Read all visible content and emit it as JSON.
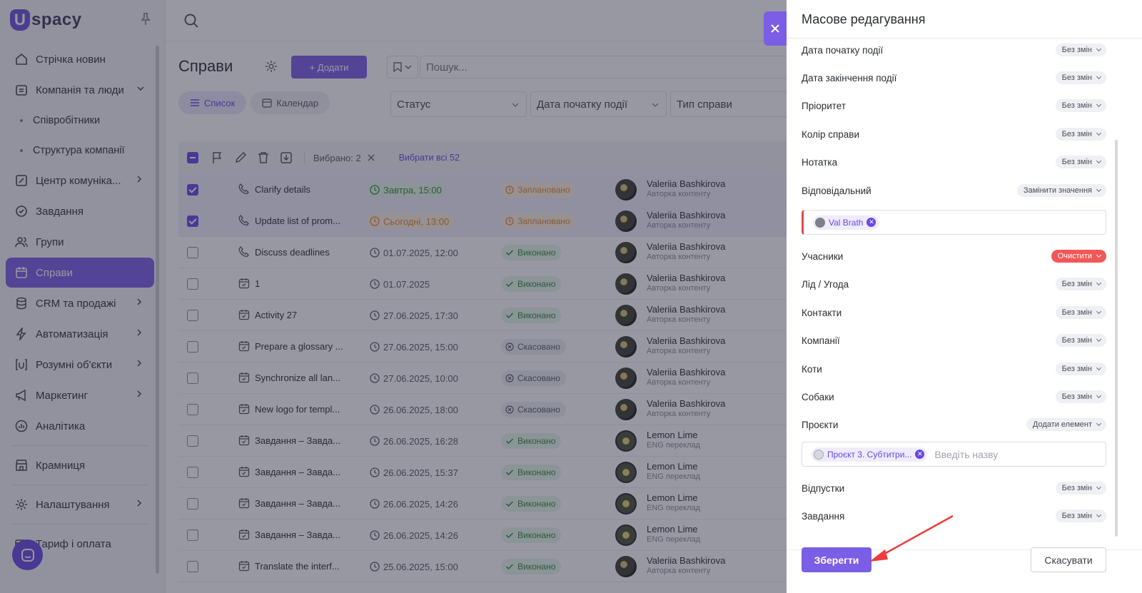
{
  "sidebar": {
    "logo": "spacy",
    "logo_mark": "U",
    "items": [
      {
        "label": "Стрічка новин",
        "icon": "home-icon"
      },
      {
        "label": "Компанія та люди",
        "icon": "building-icon"
      },
      {
        "label": "Співробітники"
      },
      {
        "label": "Структура компанії"
      },
      {
        "label": "Центр комуніка...",
        "icon": "chat-edit-icon"
      },
      {
        "label": "Завдання",
        "icon": "check-circle-icon"
      },
      {
        "label": "Групи",
        "icon": "group-icon"
      },
      {
        "label": "Справи",
        "icon": "calendar-icon"
      },
      {
        "label": "CRM та продажі",
        "icon": "database-icon"
      },
      {
        "label": "Автоматизація",
        "icon": "lightning-icon"
      },
      {
        "label": "Розумні об'єкти",
        "icon": "smart-object-icon"
      },
      {
        "label": "Маркетинг",
        "icon": "megaphone-icon"
      },
      {
        "label": "Аналітика",
        "icon": "chart-icon"
      },
      {
        "label": "Крамниця",
        "icon": "store-icon"
      },
      {
        "label": "Налаштування",
        "icon": "gear-icon"
      },
      {
        "label": "Тариф і оплата",
        "icon": "card-icon"
      }
    ]
  },
  "main": {
    "title": "Справи",
    "add_label": "+ Додати",
    "search_placeholder": "Пошук...",
    "views": {
      "list": "Список",
      "calendar": "Календар"
    },
    "filters": [
      "Статус",
      "Дата початку події",
      "Тип справи"
    ],
    "toolbar": {
      "selected": "Вибрано: 2",
      "select_all": "Вибрати всі 52"
    },
    "rows": [
      {
        "name": "Clarify details",
        "date": "Завтра, 15:00",
        "status": "Заплановано",
        "person": "Valeriia Bashkirova",
        "role": "Авторка контенту",
        "selected": true
      },
      {
        "name": "Update list of prom...",
        "date": "Сьогодні, 13:00",
        "status": "Заплановано",
        "person": "Valeriia Bashkirova",
        "role": "Авторка контенту",
        "selected": true
      },
      {
        "name": "Discuss deadlines",
        "date": "01.07.2025, 12:00",
        "status": "Виконано",
        "person": "Valeriia Bashkirova",
        "role": "Авторка контенту",
        "selected": false
      },
      {
        "name": "1",
        "date": "01.07.2025",
        "status": "Виконано",
        "person": "Valeriia Bashkirova",
        "role": "Авторка контенту",
        "selected": false
      },
      {
        "name": "Activity 27",
        "date": "27.06.2025, 17:30",
        "status": "Виконано",
        "person": "Valeriia Bashkirova",
        "role": "Авторка контенту",
        "selected": false
      },
      {
        "name": "Prepare a glossary ...",
        "date": "27.06.2025, 15:00",
        "status": "Скасовано",
        "person": "Valeriia Bashkirova",
        "role": "Авторка контенту",
        "selected": false
      },
      {
        "name": "Synchronize all lan...",
        "date": "27.06.2025, 10:00",
        "status": "Скасовано",
        "person": "Valeriia Bashkirova",
        "role": "Авторка контенту",
        "selected": false
      },
      {
        "name": "New logo for templ...",
        "date": "26.06.2025, 18:00",
        "status": "Скасовано",
        "person": "Valeriia Bashkirova",
        "role": "Авторка контенту",
        "selected": false
      },
      {
        "name": "Завдання – Завда...",
        "date": "26.06.2025, 16:28",
        "status": "Виконано",
        "person": "Lemon Lime",
        "role": "ENG переклад",
        "selected": false
      },
      {
        "name": "Завдання – Завда...",
        "date": "26.06.2025, 15:37",
        "status": "Виконано",
        "person": "Lemon Lime",
        "role": "ENG переклад",
        "selected": false
      },
      {
        "name": "Завдання – Завда...",
        "date": "26.06.2025, 14:26",
        "status": "Виконано",
        "person": "Lemon Lime",
        "role": "ENG переклад",
        "selected": false
      },
      {
        "name": "Завдання – Завда...",
        "date": "26.06.2025, 14:26",
        "status": "Виконано",
        "person": "Lemon Lime",
        "role": "ENG переклад",
        "selected": false
      },
      {
        "name": "Translate the interf...",
        "date": "25.06.2025, 15:00",
        "status": "Виконано",
        "person": "Valeriia Bashkirova",
        "role": "Авторка контенту",
        "selected": false
      }
    ]
  },
  "panel": {
    "title": "Масове редагування",
    "fields": [
      {
        "label": "Дата початку події",
        "value": "Без змін"
      },
      {
        "label": "Дата закінчення події",
        "value": "Без змін"
      },
      {
        "label": "Пріоритет",
        "value": "Без змін"
      },
      {
        "label": "Колір справи",
        "value": "Без змін"
      },
      {
        "label": "Нотатка",
        "value": "Без змін"
      },
      {
        "label": "Відповідальний",
        "value": "Замінити значення"
      },
      {
        "label": "Учасники",
        "value": "Очистити"
      },
      {
        "label": "Лід / Угода",
        "value": "Без змін"
      },
      {
        "label": "Контакти",
        "value": "Без змін"
      },
      {
        "label": "Компанії",
        "value": "Без змін"
      },
      {
        "label": "Коти",
        "value": "Без змін"
      },
      {
        "label": "Собаки",
        "value": "Без змін"
      },
      {
        "label": "Проєкти",
        "value": "Додати елемент"
      },
      {
        "label": "Відпустки",
        "value": "Без змін"
      },
      {
        "label": "Завдання",
        "value": "Без змін"
      }
    ],
    "responsible_chip": "Val Brath",
    "project_chip": "Проєкт 3. Субтитри...",
    "project_placeholder": "Введіть назву",
    "save_label": "Зберегти",
    "cancel_label": "Скасувати"
  },
  "colors": {
    "accent": "#7b5ee6",
    "danger": "#f25757",
    "success": "#2e8b3c",
    "warning": "#e08a2c"
  }
}
